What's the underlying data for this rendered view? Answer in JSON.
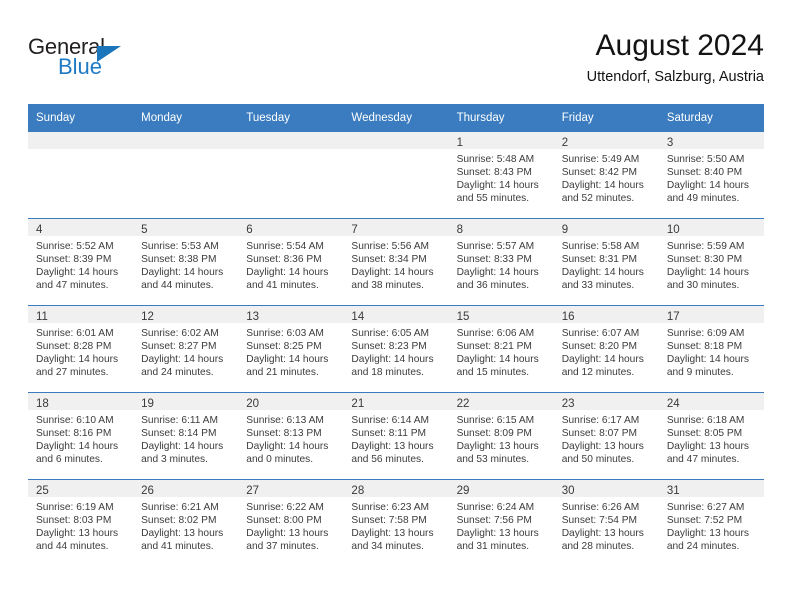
{
  "brand": {
    "name_part1": "General",
    "name_part2": "Blue",
    "triangle_color": "#1b75bb",
    "blue_color": "#1f7ac4"
  },
  "header": {
    "month_title": "August 2024",
    "location": "Uttendorf, Salzburg, Austria"
  },
  "theme": {
    "header_bg": "#3a7cbf",
    "daynum_bg": "#f0f0f0",
    "text": "#3c3c3c"
  },
  "weekdays": [
    "Sunday",
    "Monday",
    "Tuesday",
    "Wednesday",
    "Thursday",
    "Friday",
    "Saturday"
  ],
  "weeks": [
    [
      {
        "day": "",
        "empty": true,
        "l1": "",
        "l2": "",
        "l3": "",
        "l4": ""
      },
      {
        "day": "",
        "empty": true,
        "l1": "",
        "l2": "",
        "l3": "",
        "l4": ""
      },
      {
        "day": "",
        "empty": true,
        "l1": "",
        "l2": "",
        "l3": "",
        "l4": ""
      },
      {
        "day": "",
        "empty": true,
        "l1": "",
        "l2": "",
        "l3": "",
        "l4": ""
      },
      {
        "day": "1",
        "empty": false,
        "l1": "Sunrise: 5:48 AM",
        "l2": "Sunset: 8:43 PM",
        "l3": "Daylight: 14 hours",
        "l4": "and 55 minutes."
      },
      {
        "day": "2",
        "empty": false,
        "l1": "Sunrise: 5:49 AM",
        "l2": "Sunset: 8:42 PM",
        "l3": "Daylight: 14 hours",
        "l4": "and 52 minutes."
      },
      {
        "day": "3",
        "empty": false,
        "l1": "Sunrise: 5:50 AM",
        "l2": "Sunset: 8:40 PM",
        "l3": "Daylight: 14 hours",
        "l4": "and 49 minutes."
      }
    ],
    [
      {
        "day": "4",
        "empty": false,
        "l1": "Sunrise: 5:52 AM",
        "l2": "Sunset: 8:39 PM",
        "l3": "Daylight: 14 hours",
        "l4": "and 47 minutes."
      },
      {
        "day": "5",
        "empty": false,
        "l1": "Sunrise: 5:53 AM",
        "l2": "Sunset: 8:38 PM",
        "l3": "Daylight: 14 hours",
        "l4": "and 44 minutes."
      },
      {
        "day": "6",
        "empty": false,
        "l1": "Sunrise: 5:54 AM",
        "l2": "Sunset: 8:36 PM",
        "l3": "Daylight: 14 hours",
        "l4": "and 41 minutes."
      },
      {
        "day": "7",
        "empty": false,
        "l1": "Sunrise: 5:56 AM",
        "l2": "Sunset: 8:34 PM",
        "l3": "Daylight: 14 hours",
        "l4": "and 38 minutes."
      },
      {
        "day": "8",
        "empty": false,
        "l1": "Sunrise: 5:57 AM",
        "l2": "Sunset: 8:33 PM",
        "l3": "Daylight: 14 hours",
        "l4": "and 36 minutes."
      },
      {
        "day": "9",
        "empty": false,
        "l1": "Sunrise: 5:58 AM",
        "l2": "Sunset: 8:31 PM",
        "l3": "Daylight: 14 hours",
        "l4": "and 33 minutes."
      },
      {
        "day": "10",
        "empty": false,
        "l1": "Sunrise: 5:59 AM",
        "l2": "Sunset: 8:30 PM",
        "l3": "Daylight: 14 hours",
        "l4": "and 30 minutes."
      }
    ],
    [
      {
        "day": "11",
        "empty": false,
        "l1": "Sunrise: 6:01 AM",
        "l2": "Sunset: 8:28 PM",
        "l3": "Daylight: 14 hours",
        "l4": "and 27 minutes."
      },
      {
        "day": "12",
        "empty": false,
        "l1": "Sunrise: 6:02 AM",
        "l2": "Sunset: 8:27 PM",
        "l3": "Daylight: 14 hours",
        "l4": "and 24 minutes."
      },
      {
        "day": "13",
        "empty": false,
        "l1": "Sunrise: 6:03 AM",
        "l2": "Sunset: 8:25 PM",
        "l3": "Daylight: 14 hours",
        "l4": "and 21 minutes."
      },
      {
        "day": "14",
        "empty": false,
        "l1": "Sunrise: 6:05 AM",
        "l2": "Sunset: 8:23 PM",
        "l3": "Daylight: 14 hours",
        "l4": "and 18 minutes."
      },
      {
        "day": "15",
        "empty": false,
        "l1": "Sunrise: 6:06 AM",
        "l2": "Sunset: 8:21 PM",
        "l3": "Daylight: 14 hours",
        "l4": "and 15 minutes."
      },
      {
        "day": "16",
        "empty": false,
        "l1": "Sunrise: 6:07 AM",
        "l2": "Sunset: 8:20 PM",
        "l3": "Daylight: 14 hours",
        "l4": "and 12 minutes."
      },
      {
        "day": "17",
        "empty": false,
        "l1": "Sunrise: 6:09 AM",
        "l2": "Sunset: 8:18 PM",
        "l3": "Daylight: 14 hours",
        "l4": "and 9 minutes."
      }
    ],
    [
      {
        "day": "18",
        "empty": false,
        "l1": "Sunrise: 6:10 AM",
        "l2": "Sunset: 8:16 PM",
        "l3": "Daylight: 14 hours",
        "l4": "and 6 minutes."
      },
      {
        "day": "19",
        "empty": false,
        "l1": "Sunrise: 6:11 AM",
        "l2": "Sunset: 8:14 PM",
        "l3": "Daylight: 14 hours",
        "l4": "and 3 minutes."
      },
      {
        "day": "20",
        "empty": false,
        "l1": "Sunrise: 6:13 AM",
        "l2": "Sunset: 8:13 PM",
        "l3": "Daylight: 14 hours",
        "l4": "and 0 minutes."
      },
      {
        "day": "21",
        "empty": false,
        "l1": "Sunrise: 6:14 AM",
        "l2": "Sunset: 8:11 PM",
        "l3": "Daylight: 13 hours",
        "l4": "and 56 minutes."
      },
      {
        "day": "22",
        "empty": false,
        "l1": "Sunrise: 6:15 AM",
        "l2": "Sunset: 8:09 PM",
        "l3": "Daylight: 13 hours",
        "l4": "and 53 minutes."
      },
      {
        "day": "23",
        "empty": false,
        "l1": "Sunrise: 6:17 AM",
        "l2": "Sunset: 8:07 PM",
        "l3": "Daylight: 13 hours",
        "l4": "and 50 minutes."
      },
      {
        "day": "24",
        "empty": false,
        "l1": "Sunrise: 6:18 AM",
        "l2": "Sunset: 8:05 PM",
        "l3": "Daylight: 13 hours",
        "l4": "and 47 minutes."
      }
    ],
    [
      {
        "day": "25",
        "empty": false,
        "l1": "Sunrise: 6:19 AM",
        "l2": "Sunset: 8:03 PM",
        "l3": "Daylight: 13 hours",
        "l4": "and 44 minutes."
      },
      {
        "day": "26",
        "empty": false,
        "l1": "Sunrise: 6:21 AM",
        "l2": "Sunset: 8:02 PM",
        "l3": "Daylight: 13 hours",
        "l4": "and 41 minutes."
      },
      {
        "day": "27",
        "empty": false,
        "l1": "Sunrise: 6:22 AM",
        "l2": "Sunset: 8:00 PM",
        "l3": "Daylight: 13 hours",
        "l4": "and 37 minutes."
      },
      {
        "day": "28",
        "empty": false,
        "l1": "Sunrise: 6:23 AM",
        "l2": "Sunset: 7:58 PM",
        "l3": "Daylight: 13 hours",
        "l4": "and 34 minutes."
      },
      {
        "day": "29",
        "empty": false,
        "l1": "Sunrise: 6:24 AM",
        "l2": "Sunset: 7:56 PM",
        "l3": "Daylight: 13 hours",
        "l4": "and 31 minutes."
      },
      {
        "day": "30",
        "empty": false,
        "l1": "Sunrise: 6:26 AM",
        "l2": "Sunset: 7:54 PM",
        "l3": "Daylight: 13 hours",
        "l4": "and 28 minutes."
      },
      {
        "day": "31",
        "empty": false,
        "l1": "Sunrise: 6:27 AM",
        "l2": "Sunset: 7:52 PM",
        "l3": "Daylight: 13 hours",
        "l4": "and 24 minutes."
      }
    ]
  ]
}
